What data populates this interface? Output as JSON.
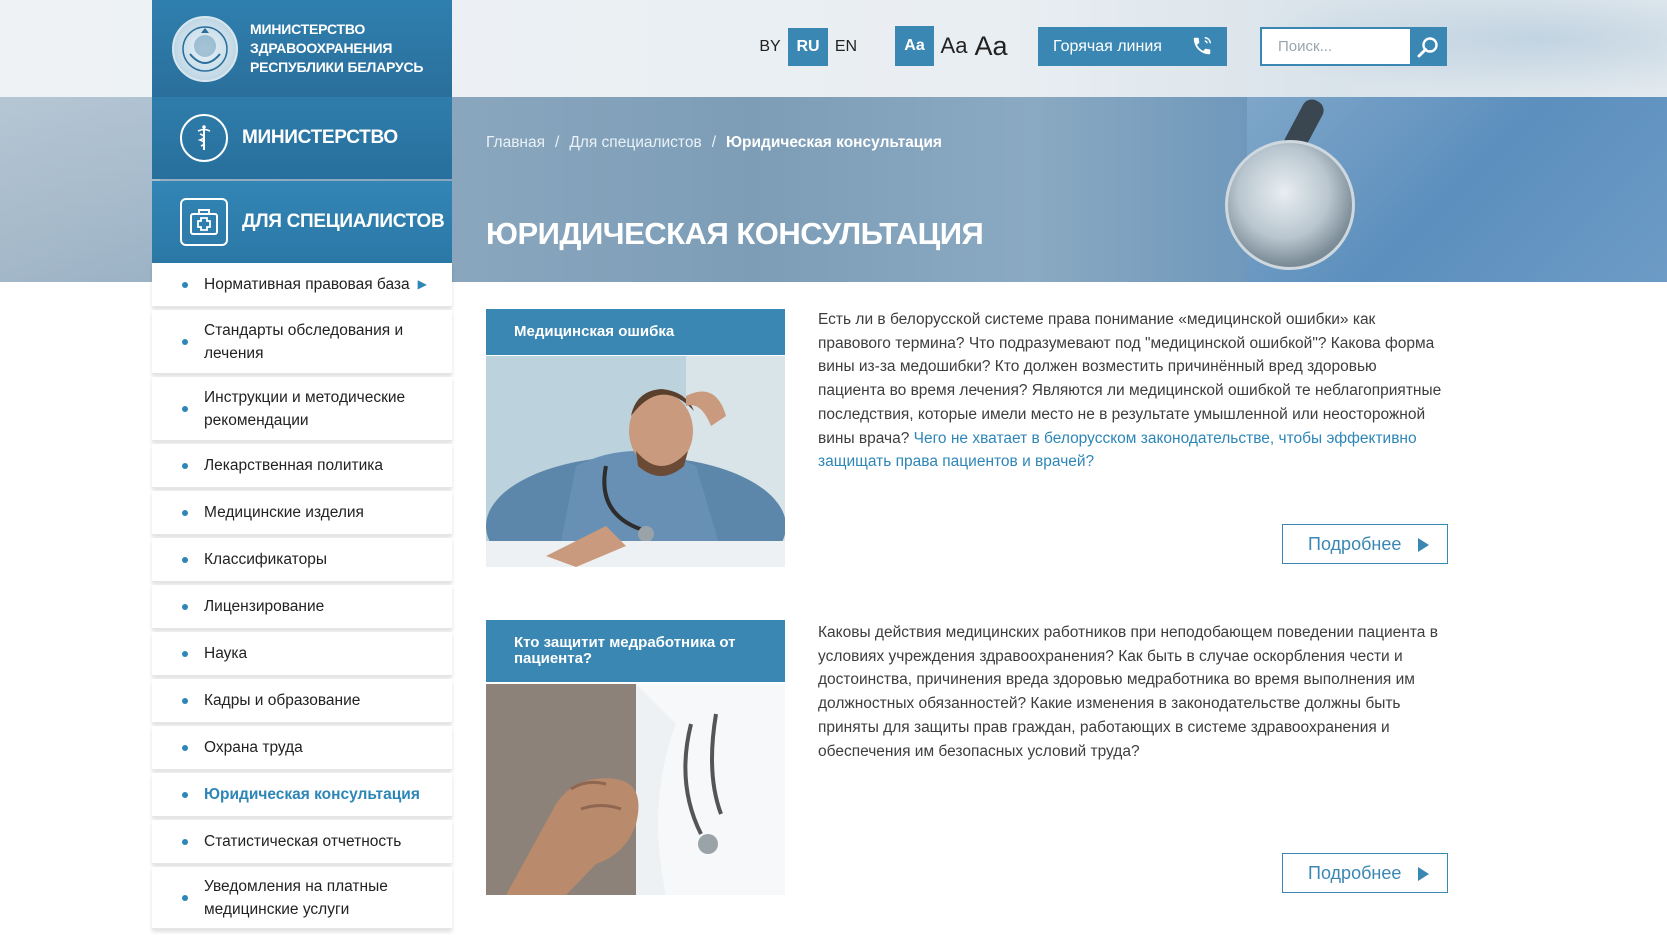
{
  "header": {
    "logo_text": "МИНИСТЕРСТВО\nЗДРАВООХРАНЕНИЯ\nРЕСПУБЛИКИ БЕЛАРУСЬ",
    "logo_lines": [
      "МИНИСТЕРСТВО",
      "ЗДРАВООХРАНЕНИЯ",
      "РЕСПУБЛИКИ БЕЛАРУСЬ"
    ],
    "languages": [
      "BY",
      "RU",
      "EN"
    ],
    "active_language": "RU",
    "font_sizes": [
      "Aa",
      "Aa",
      "Aa"
    ],
    "hotline_label": "Горячая линия",
    "search_placeholder": "Поиск..."
  },
  "nav": {
    "ministry_label": "Министерство",
    "specialists_label": "Для специалистов",
    "sub_items": [
      {
        "label": "Нормативная правовая база",
        "has_arrow": true
      },
      {
        "label": "Стандарты обследования и лечения"
      },
      {
        "label": "Инструкции и методические рекомендации"
      },
      {
        "label": "Лекарственная политика"
      },
      {
        "label": "Медицинские изделия"
      },
      {
        "label": "Классификаторы"
      },
      {
        "label": "Лицензирование"
      },
      {
        "label": "Наука"
      },
      {
        "label": "Кадры и образование"
      },
      {
        "label": "Охрана труда"
      },
      {
        "label": "Юридическая консультация",
        "active": true
      },
      {
        "label": "Статистическая отчетность"
      },
      {
        "label": "Уведомления на платные медицинские услуги"
      }
    ]
  },
  "breadcrumbs": [
    "Главная",
    "Для специалистов",
    "Юридическая консультация"
  ],
  "page_title": "Юридическая консультация",
  "articles": [
    {
      "title": "Медицинская ошибка",
      "text": "Есть ли в белорусской системе права понимание «медицинской ошибки» как правового термина? Что подразумевают под \"медицинской ошибкой\"? Какова форма вины из-за медошибки? Кто должен возместить причинённый вред здоровью пациента во время лечения? Являются ли медицинской ошибкой те неблагоприятные последствия, которые имели место не в результате умышленной или неосторожной вины врача? ",
      "link_text": "Чего не хватает в белорусском законодательстве, чтобы эффективно защищать права пациентов и врачей?",
      "more_label": "Подробнее"
    },
    {
      "title": "Кто защитит медработника от пациента?",
      "text": "Каковы действия медицинских работников при неподобающем поведении пациента в условиях учреждения здравоохранения? Как быть в случае оскорбления чести и достоинства, причинения вреда здоровью медработника во время выполнения им должностных обязанностей?  Какие изменения в законодательстве должны быть приняты для защиты прав граждан, работающих в системе здравоохранения и обеспечения им безопасных условий труда?",
      "more_label": "Подробнее"
    }
  ],
  "colors": {
    "accent": "#3a87b4",
    "link": "#2d86b7",
    "nav_dark": "#276f9c"
  }
}
